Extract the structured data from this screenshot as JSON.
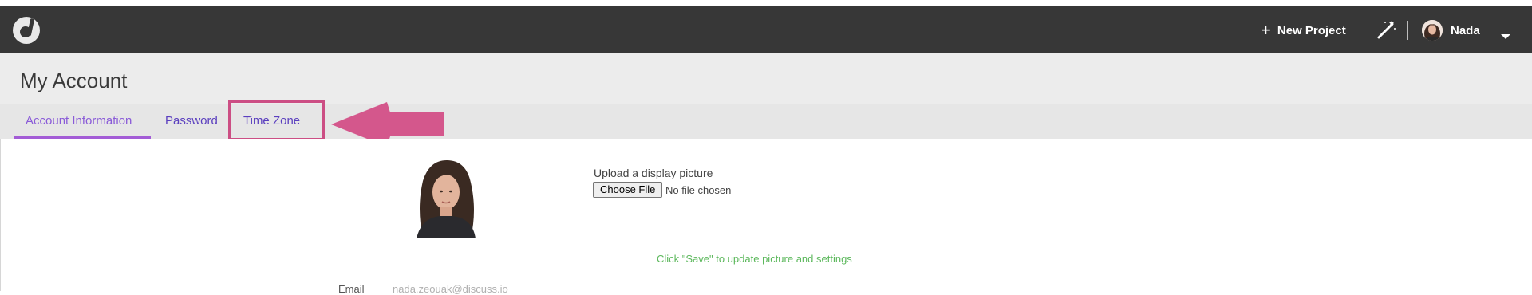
{
  "navbar": {
    "new_project_label": "New Project",
    "user_name": "Nada",
    "icons": [
      "discuss-logo-icon",
      "plus-icon",
      "magic-wand-icon",
      "user-avatar",
      "caret-down-icon"
    ]
  },
  "header": {
    "title": "My Account"
  },
  "tabs": [
    {
      "label": "Account Information",
      "active": true
    },
    {
      "label": "Password",
      "active": false
    },
    {
      "label": "Time Zone",
      "active": false
    }
  ],
  "annotation": {
    "color": "#cc4e84",
    "target": "Time Zone"
  },
  "upload": {
    "label": "Upload a display picture",
    "button_label": "Choose File",
    "status": "No file chosen"
  },
  "save_note": "Click \"Save\" to update picture and settings",
  "email": {
    "label": "Email",
    "value": "nada.zeouak@discuss.io"
  },
  "colors": {
    "navbar": "#373737",
    "accent": "#5b3fbf",
    "active_tab_underline": "#a35cd6",
    "success_text": "#5cb85c"
  }
}
